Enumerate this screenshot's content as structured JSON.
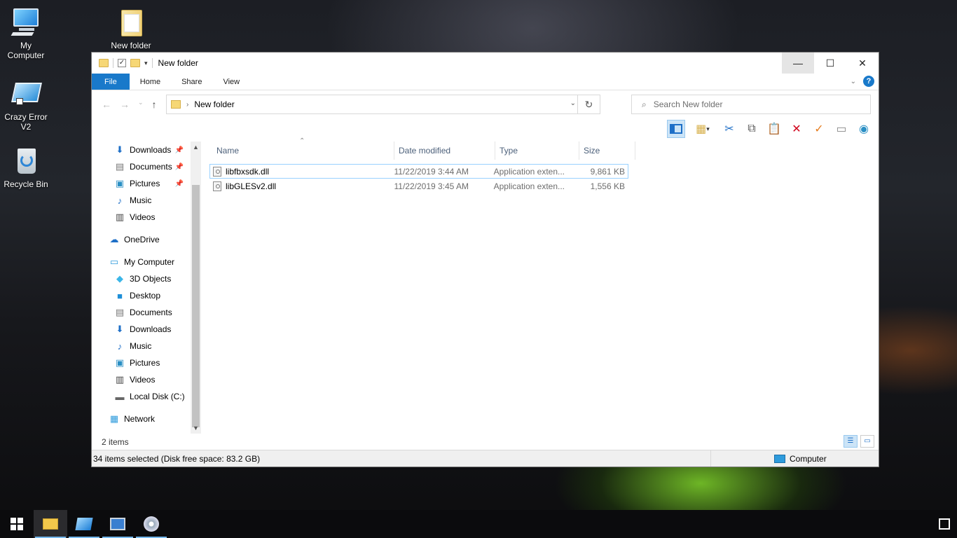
{
  "desktop": {
    "icons": [
      {
        "label": "My\nComputer",
        "line1": "My",
        "line2": "Computer",
        "icon": "monitor-icon"
      },
      {
        "label": "New folder",
        "line1": "New folder",
        "line2": "",
        "icon": "folder-icon"
      },
      {
        "label": "Crazy Error V2",
        "line1": "Crazy Error",
        "line2": "V2",
        "icon": "app-shortcut-icon"
      },
      {
        "label": "Recycle Bin",
        "line1": "Recycle Bin",
        "line2": "",
        "icon": "recycle-bin-icon"
      }
    ]
  },
  "window": {
    "title": "New folder",
    "controls": {
      "minimize": "—",
      "maximize": "☐",
      "close": "✕"
    },
    "ribbon_tabs": [
      "File",
      "Home",
      "Share",
      "View"
    ],
    "help": "?",
    "address": {
      "path": "New folder",
      "separator": "›"
    },
    "search": {
      "placeholder": "Search New folder"
    },
    "nav_pane": [
      {
        "label": "Downloads",
        "icon": "downloads-icon",
        "pinned": true
      },
      {
        "label": "Documents",
        "icon": "documents-icon",
        "pinned": true
      },
      {
        "label": "Pictures",
        "icon": "pictures-icon",
        "pinned": true
      },
      {
        "label": "Music",
        "icon": "music-icon",
        "pinned": false
      },
      {
        "label": "Videos",
        "icon": "videos-icon",
        "pinned": false
      },
      {
        "label": "OneDrive",
        "icon": "onedrive-icon",
        "pinned": false
      },
      {
        "label": "My Computer",
        "icon": "computer-icon",
        "pinned": false
      },
      {
        "label": "3D Objects",
        "icon": "3d-objects-icon",
        "pinned": false
      },
      {
        "label": "Desktop",
        "icon": "desktop-icon",
        "pinned": false
      },
      {
        "label": "Documents",
        "icon": "documents-icon",
        "pinned": false
      },
      {
        "label": "Downloads",
        "icon": "downloads-icon",
        "pinned": false
      },
      {
        "label": "Music",
        "icon": "music-icon",
        "pinned": false
      },
      {
        "label": "Pictures",
        "icon": "pictures-icon",
        "pinned": false
      },
      {
        "label": "Videos",
        "icon": "videos-icon",
        "pinned": false
      },
      {
        "label": "Local Disk (C:)",
        "icon": "local-disk-icon",
        "pinned": false
      },
      {
        "label": "Network",
        "icon": "network-icon",
        "pinned": false
      }
    ],
    "columns": {
      "name": "Name",
      "date": "Date modified",
      "type": "Type",
      "size": "Size"
    },
    "files": [
      {
        "name": "libfbxsdk.dll",
        "date": "11/22/2019 3:44 AM",
        "type": "Application exten...",
        "size": "9,861 KB",
        "selected": true
      },
      {
        "name": "libGLESv2.dll",
        "date": "11/22/2019 3:45 AM",
        "type": "Application exten...",
        "size": "1,556 KB",
        "selected": false
      }
    ],
    "item_count": "2 items",
    "status_left": "34 items selected (Disk free space: 83.2 GB)",
    "status_right": "Computer"
  },
  "colors": {
    "accent": "#1979ca",
    "selection_border": "#99d1ff",
    "taskbar": "#0b0b0d"
  }
}
